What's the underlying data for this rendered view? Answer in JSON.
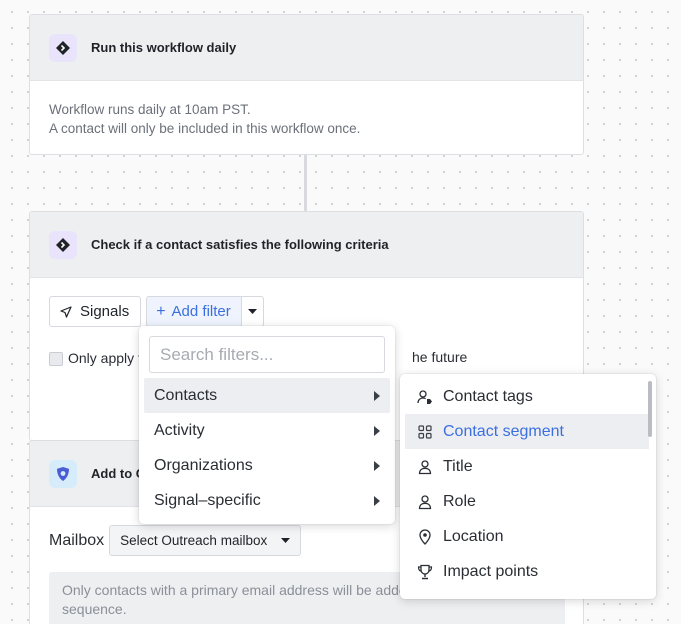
{
  "cards": [
    {
      "title": "Run this workflow daily",
      "lines": [
        "Workflow runs daily at 10am PST.",
        "A contact will only be included in this workflow once."
      ]
    },
    {
      "title": "Check if a contact satisfies the following criteria",
      "signals_label": "Signals",
      "add_filter_label": "Add filter",
      "checkbox_label": "Only apply t",
      "checkbox_tail": "he future"
    },
    {
      "title": "Add to C",
      "mailbox_label": "Mailbox",
      "mailbox_select": "Select Outreach mailbox",
      "notice": "Only contacts with a primary email address will be added",
      "notice_line2": "sequence."
    }
  ],
  "menu": {
    "search_placeholder": "Search filters...",
    "items": [
      {
        "label": "Contacts",
        "active": true
      },
      {
        "label": "Activity",
        "active": false
      },
      {
        "label": "Organizations",
        "active": false
      },
      {
        "label": "Signal–specific",
        "active": false
      }
    ]
  },
  "submenu": {
    "items": [
      {
        "label": "Contact tags",
        "icon": "person-tag-icon",
        "active": false
      },
      {
        "label": "Contact segment",
        "icon": "segment-grid-icon",
        "active": true
      },
      {
        "label": "Title",
        "icon": "person-icon",
        "active": false
      },
      {
        "label": "Role",
        "icon": "person-icon",
        "active": false
      },
      {
        "label": "Location",
        "icon": "location-pin-icon",
        "active": false
      },
      {
        "label": "Impact points",
        "icon": "trophy-icon",
        "active": false
      }
    ]
  },
  "colors": {
    "accent": "#3b6fe0",
    "purple_badge": "#e9e4fb",
    "blue_badge": "#d6ecfb"
  }
}
